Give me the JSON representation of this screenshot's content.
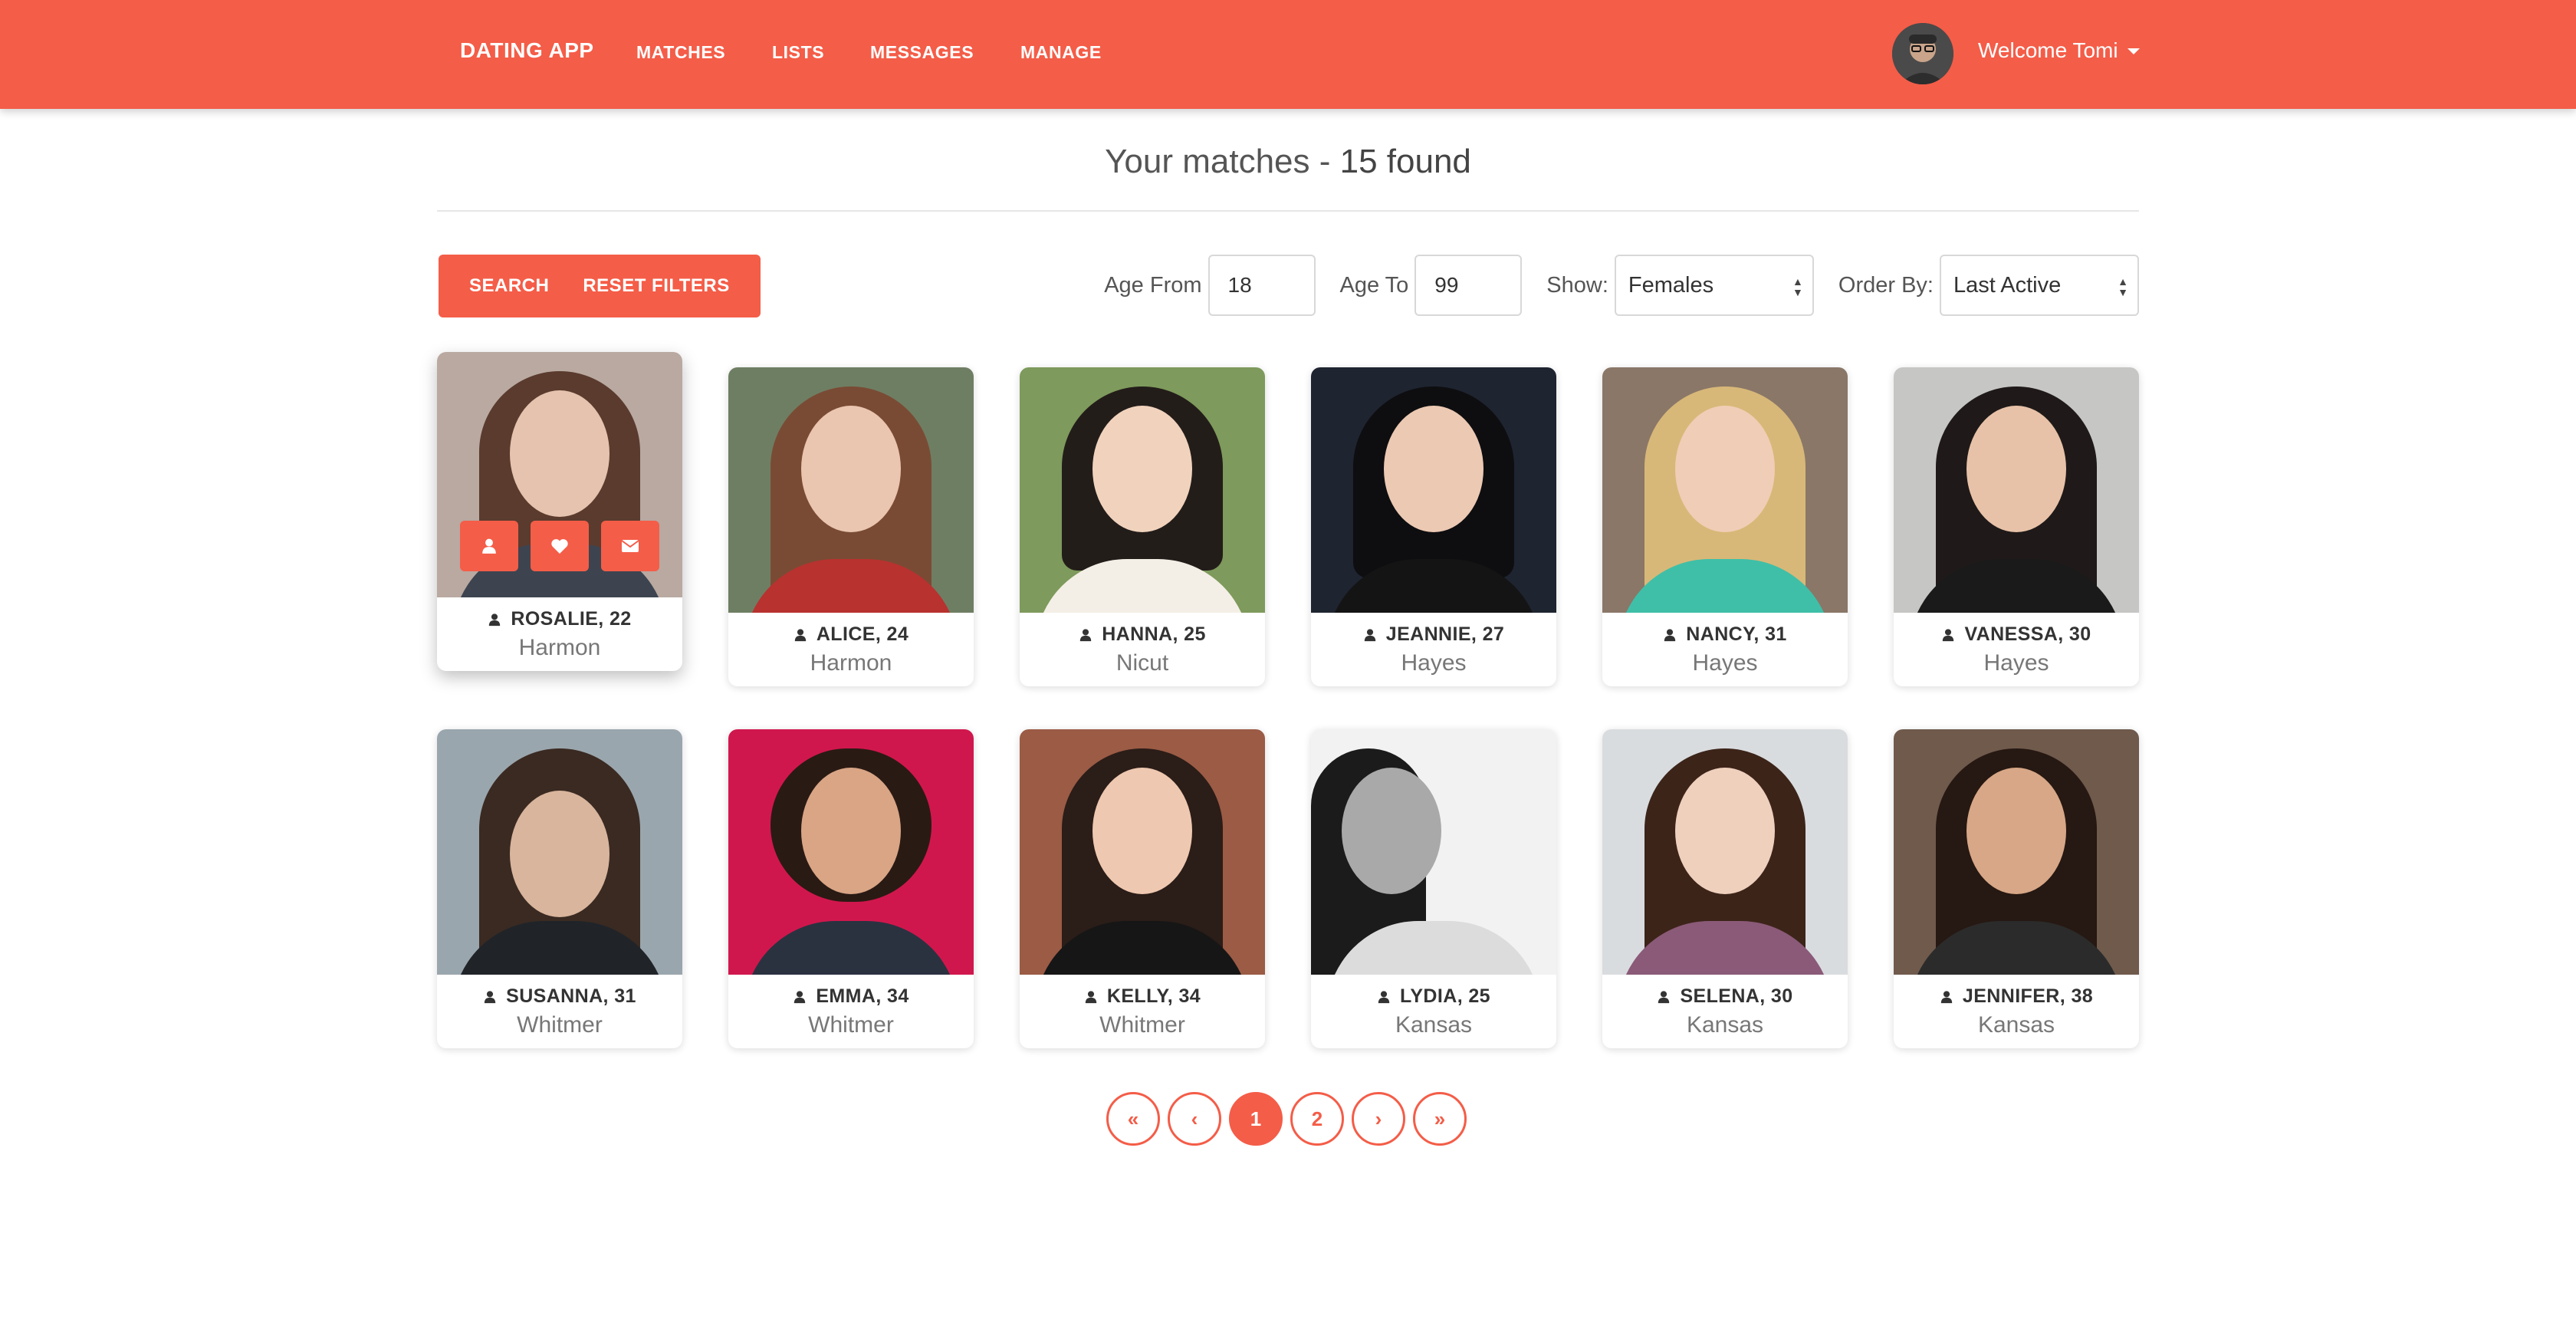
{
  "nav": {
    "brand": "DATING APP",
    "links": [
      "MATCHES",
      "LISTS",
      "MESSAGES",
      "MANAGE"
    ],
    "welcome": "Welcome Tomi"
  },
  "header": {
    "title_prefix": "Your matches - ",
    "title_count": "15 found"
  },
  "filters": {
    "search_label": "SEARCH",
    "reset_label": "RESET FILTERS",
    "age_from_label": "Age From",
    "age_from_value": "18",
    "age_to_label": "Age To",
    "age_to_value": "99",
    "show_label": "Show:",
    "show_value": "Females",
    "order_label": "Order By:",
    "order_value": "Last Active"
  },
  "members": [
    {
      "name": "ROSALIE, 22",
      "city": "Harmon"
    },
    {
      "name": "ALICE, 24",
      "city": "Harmon"
    },
    {
      "name": "HANNA, 25",
      "city": "Nicut"
    },
    {
      "name": "JEANNIE, 27",
      "city": "Hayes"
    },
    {
      "name": "NANCY, 31",
      "city": "Hayes"
    },
    {
      "name": "VANESSA, 30",
      "city": "Hayes"
    },
    {
      "name": "SUSANNA, 31",
      "city": "Whitmer"
    },
    {
      "name": "EMMA, 34",
      "city": "Whitmer"
    },
    {
      "name": "KELLY, 34",
      "city": "Whitmer"
    },
    {
      "name": "LYDIA, 25",
      "city": "Kansas"
    },
    {
      "name": "SELENA, 30",
      "city": "Kansas"
    },
    {
      "name": "JENNIFER, 38",
      "city": "Kansas"
    }
  ],
  "pagination": {
    "first": "«",
    "prev": "‹",
    "pages": [
      "1",
      "2"
    ],
    "next": "›",
    "last": "»"
  },
  "colors": {
    "accent": "#f45d48"
  },
  "icons": {
    "user": "user-icon",
    "heart": "heart-icon",
    "envelope": "envelope-icon"
  }
}
